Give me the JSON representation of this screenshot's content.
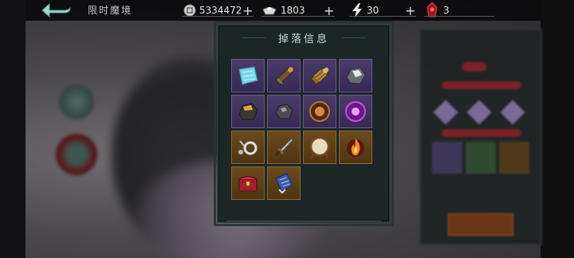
{
  "top_bar": {
    "back_icon": "back-arrow-icon",
    "scene_title": "限时魔境",
    "resources": [
      {
        "icon": "coin-icon",
        "value": "5334472",
        "has_plus": true
      },
      {
        "icon": "ingot-icon",
        "value": "1803",
        "has_plus": true
      },
      {
        "icon": "lightning-icon",
        "value": "30",
        "has_plus": true
      },
      {
        "icon": "red-crystal-icon",
        "value": "3",
        "has_plus": false
      }
    ],
    "plus_symbol": "+"
  },
  "drop_popup": {
    "title": "掉落信息",
    "items": [
      {
        "icon": "cyan-cloth-icon",
        "rarity": "purple"
      },
      {
        "icon": "wood-log-icon",
        "rarity": "purple"
      },
      {
        "icon": "bark-log-icon",
        "rarity": "purple"
      },
      {
        "icon": "silver-ore-icon",
        "rarity": "purple"
      },
      {
        "icon": "gold-ore-icon",
        "rarity": "purple"
      },
      {
        "icon": "black-stone-icon",
        "rarity": "purple"
      },
      {
        "icon": "amber-orb-icon",
        "rarity": "purple"
      },
      {
        "icon": "purple-orb-icon",
        "rarity": "purple"
      },
      {
        "icon": "ring-icon",
        "rarity": "orange"
      },
      {
        "icon": "dagger-icon",
        "rarity": "orange"
      },
      {
        "icon": "drum-icon",
        "rarity": "orange"
      },
      {
        "icon": "flame-icon",
        "rarity": "orange"
      },
      {
        "icon": "red-chest-icon",
        "rarity": "orange"
      },
      {
        "icon": "blue-scroll-icon",
        "rarity": "orange"
      }
    ]
  },
  "colors": {
    "purple_slot": "#4a3b6a",
    "orange_slot": "#6a4a1f",
    "popup_bg": "#1c2626",
    "accent_red": "#7a2228"
  }
}
